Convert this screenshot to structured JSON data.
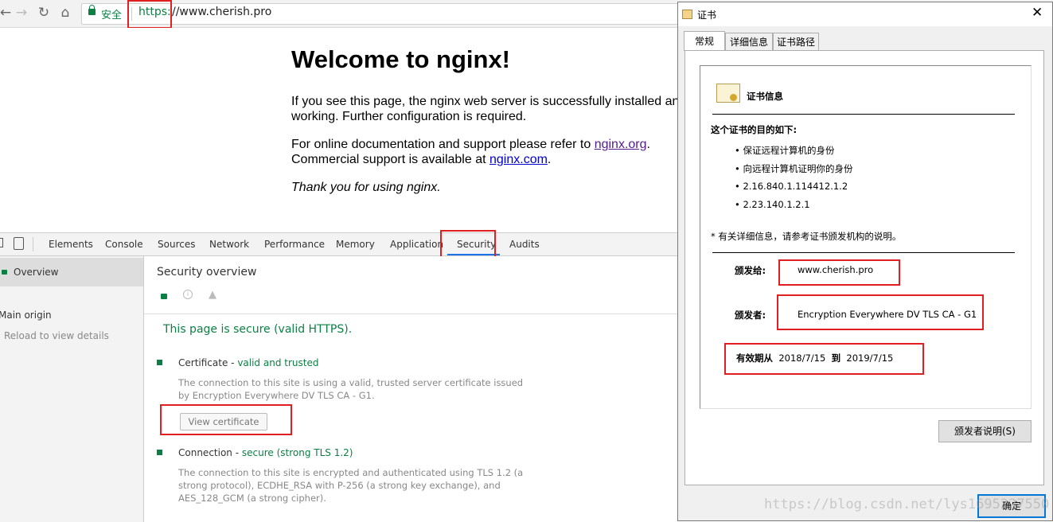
{
  "browser": {
    "secure_label": "安全",
    "url_scheme": "https:",
    "url_rest": "//www.cherish.pro"
  },
  "nginx": {
    "title": "Welcome to nginx!",
    "p1_line1": "If you see this page, the nginx web server is successfully installed and",
    "p1_line2": "working. Further configuration is required.",
    "p2_prefix": "For online documentation and support please refer to ",
    "p2_link": "nginx.org",
    "p2_line2_prefix": "Commercial support is available at ",
    "p2_link2": "nginx.com",
    "thanks": "Thank you for using nginx."
  },
  "devtools": {
    "tabs": [
      "Elements",
      "Console",
      "Sources",
      "Network",
      "Performance",
      "Memory",
      "Application",
      "Security",
      "Audits"
    ],
    "active_tab": "Security",
    "sidebar": {
      "overview": "Overview",
      "main_origin": "Main origin",
      "reload": "Reload to view details"
    },
    "header_title": "Security overview",
    "secure_msg": "This page is secure (valid HTTPS).",
    "certificate": {
      "label": "Certificate",
      "status": "valid and trusted",
      "desc_line1": "The connection to this site is using a valid, trusted server certificate issued",
      "desc_line2": "by Encryption Everywhere DV TLS CA - G1.",
      "button": "View certificate"
    },
    "connection": {
      "label": "Connection",
      "status": "secure (strong TLS 1.2)",
      "desc_line1": "The connection to this site is encrypted and authenticated using TLS 1.2 (a",
      "desc_line2": "strong protocol), ECDHE_RSA with P-256 (a strong key exchange), and",
      "desc_line3": "AES_128_GCM (a strong cipher)."
    }
  },
  "dialog": {
    "title": "证书",
    "tabs": [
      "常规",
      "详细信息",
      "证书路径"
    ],
    "info_heading": "证书信息",
    "purpose_heading": "这个证书的目的如下:",
    "purposes": [
      "保证远程计算机的身份",
      "向远程计算机证明你的身份",
      "2.16.840.1.114412.1.2",
      "2.23.140.1.2.1"
    ],
    "note": "* 有关详细信息，请参考证书颁发机构的说明。",
    "issued_to_label": "颁发给:",
    "issued_to": "www.cherish.pro",
    "issued_by_label": "颁发者:",
    "issued_by": "Encryption Everywhere DV TLS CA - G1",
    "valid_from_label": "有效期从",
    "valid_from": "2018/7/15",
    "valid_to_label": "到",
    "valid_to": "2019/7/15",
    "issuer_statement_button": "颁发者说明(S)",
    "ok_button": "确定"
  },
  "watermark": "https://blog.csdn.net/lys1695227550"
}
